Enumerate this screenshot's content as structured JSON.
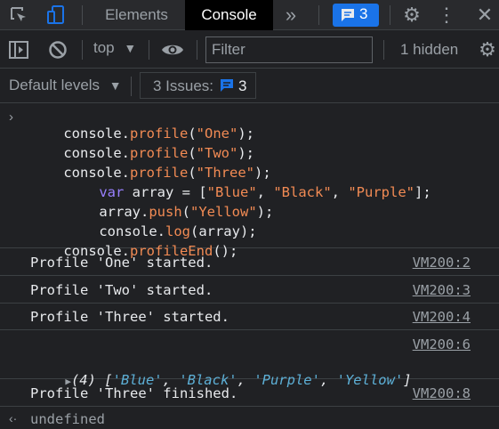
{
  "tabs": {
    "elements": "Elements",
    "console": "Console",
    "more": "»",
    "message_count": "3"
  },
  "toolbar": {
    "context": "top",
    "filter_placeholder": "Filter",
    "hidden": "1 hidden"
  },
  "levels": {
    "default_levels": "Default levels",
    "issues_label": "3 Issues:",
    "issues_count": "3"
  },
  "code_lines": [
    [
      "console.",
      "profile",
      "(",
      "\"One\"",
      ");"
    ],
    [
      "console.",
      "profile",
      "(",
      "\"Two\"",
      ");"
    ],
    [
      "console.",
      "profile",
      "(",
      "\"Three\"",
      ");"
    ]
  ],
  "code_var": {
    "kw": "var",
    "rest": " array = [",
    "s1": "\"Blue\"",
    "s2": "\"Black\"",
    "s3": "\"Purple\"",
    "end": "];"
  },
  "code_push": {
    "pre": "array.",
    "fn": "push",
    "open": "(",
    "arg": "\"Yellow\"",
    "close": ");"
  },
  "code_log": {
    "pre": "console.",
    "fn": "log",
    "rest": "(array);"
  },
  "code_end": {
    "pre": "console.",
    "fn": "profileEnd",
    "rest": "();"
  },
  "messages": [
    {
      "text": "Profile 'One' started.",
      "source": "VM200:2"
    },
    {
      "text": "Profile 'Two' started.",
      "source": "VM200:3"
    },
    {
      "text": "Profile 'Three' started.",
      "source": "VM200:4"
    }
  ],
  "array_log": {
    "source": "VM200:6",
    "length": "(4)",
    "items": [
      "'Blue'",
      "'Black'",
      "'Purple'",
      "'Yellow'"
    ]
  },
  "finished": {
    "text": "Profile 'Three' finished.",
    "source": "VM200:8"
  },
  "result": "undefined"
}
